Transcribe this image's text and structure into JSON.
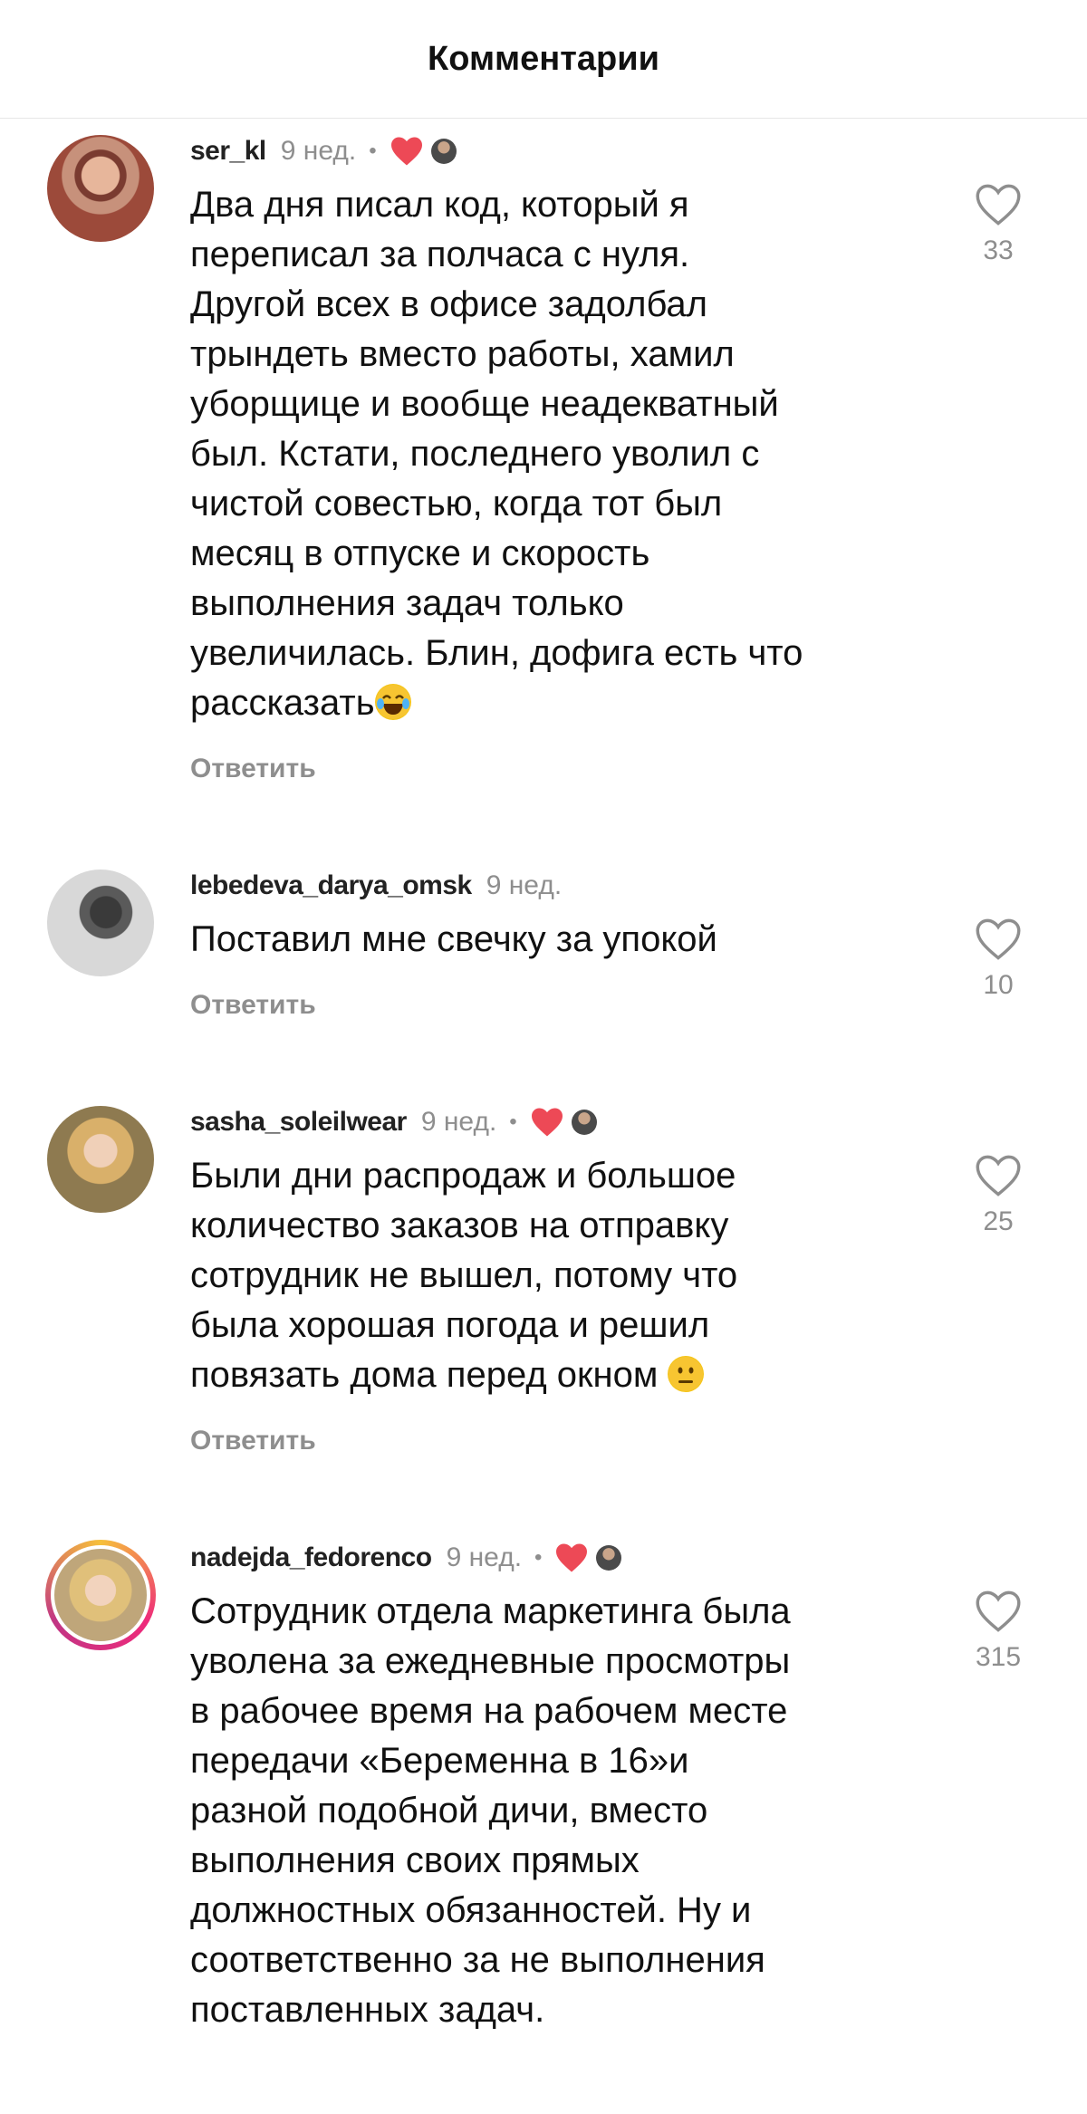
{
  "header": {
    "title": "Комментарии"
  },
  "comments": [
    {
      "username": "ser_kl",
      "time": "9 нед.",
      "text": "Два дня писал код, который я\nпереписал за полчаса с нуля.\nДругой всех в офисе задолбал\nтрындеть вместо работы, хамил\nуборщице и вообще неадекватный\nбыл. Кстати, последнего уволил с\nчистой совестью, когда тот был\nмесяц в отпуске и скорость\nвыполнения задач только\nувеличилась. Блин, дофига есть что\nрассказать",
      "reply": "Ответить",
      "likes": "33"
    },
    {
      "username": "lebedeva_darya_omsk",
      "time": "9 нед.",
      "text": "Поставил мне свечку за упокой",
      "reply": "Ответить",
      "likes": "10"
    },
    {
      "username": "sasha_soleilwear",
      "time": "9 нед.",
      "text": "Были дни распродаж и большое\nколичество заказов на отправку\nсотрудник не вышел, потому что\nбыла хорошая погода и решил\nповязать дома перед окном",
      "reply": "Ответить",
      "likes": "25"
    },
    {
      "username": "nadejda_fedorenco",
      "time": "9 нед.",
      "text": "Сотрудник отдела маркетинга была\nуволена за ежедневные просмотры\nв рабочее время на рабочем месте\nпередачи «Беременна в 16»и\nразной подобной дичи, вместо\nвыполнения своих прямых\nдолжностных обязанностей. Ну и\nсоответственно за не выполнения\nпоставленных задач.",
      "likes": "315"
    }
  ],
  "colors": {
    "liked": "#ed4956",
    "muted": "#8e8e8e"
  }
}
